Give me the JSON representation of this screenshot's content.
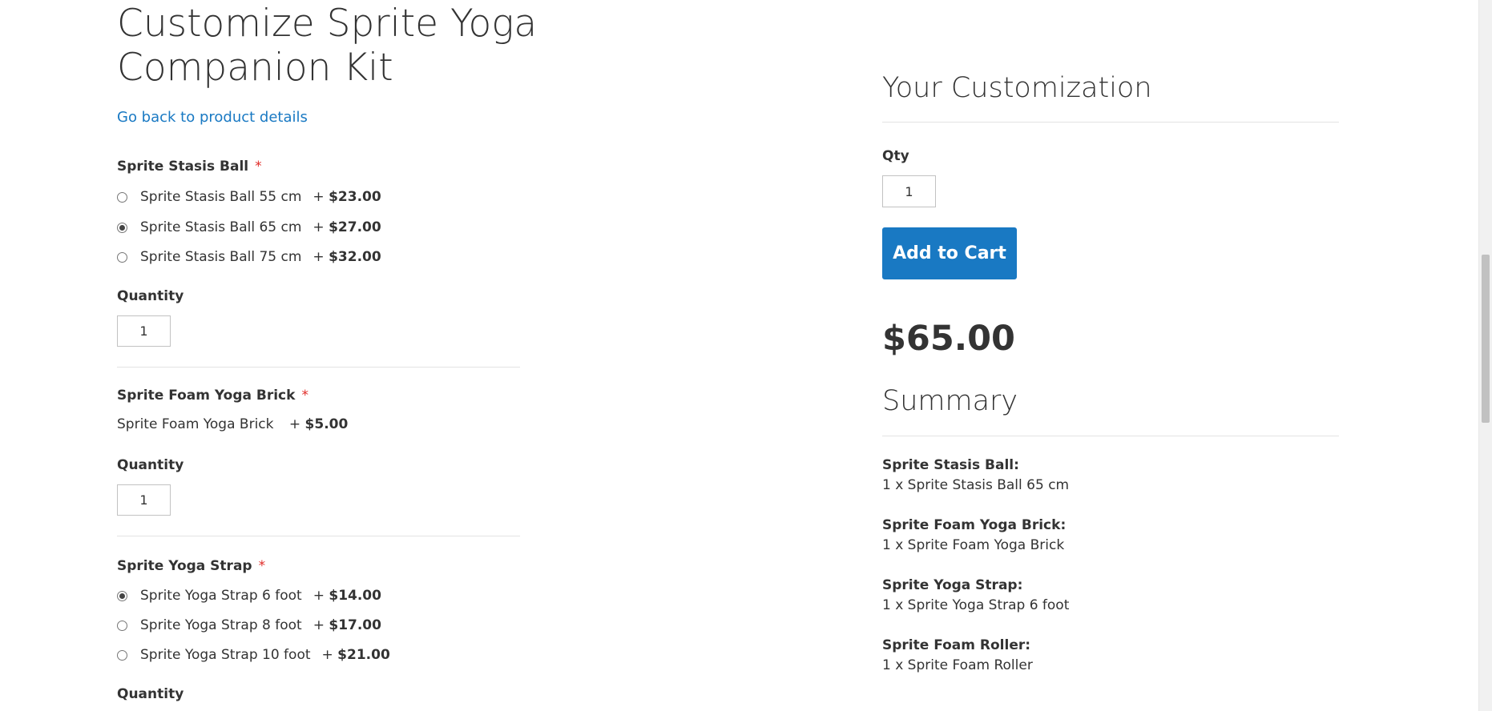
{
  "page": {
    "title_line1": "Customize Sprite Yoga",
    "title_line2": "Companion Kit",
    "back_link": "Go back to product details"
  },
  "options": {
    "ball": {
      "label": "Sprite Stasis Ball",
      "required_mark": "*",
      "choices": [
        {
          "name": "Sprite Stasis Ball 55 cm",
          "price_prefix": "+ ",
          "price": "$23.00",
          "selected": false
        },
        {
          "name": "Sprite Stasis Ball 65 cm",
          "price_prefix": "+ ",
          "price": "$27.00",
          "selected": true
        },
        {
          "name": "Sprite Stasis Ball 75 cm",
          "price_prefix": "+ ",
          "price": "$32.00",
          "selected": false
        }
      ],
      "qty_label": "Quantity",
      "qty_value": "1"
    },
    "brick": {
      "label": "Sprite Foam Yoga Brick",
      "required_mark": "*",
      "single_name": "Sprite Foam Yoga Brick",
      "price_prefix": "+ ",
      "price": "$5.00",
      "qty_label": "Quantity",
      "qty_value": "1"
    },
    "strap": {
      "label": "Sprite Yoga Strap",
      "required_mark": "*",
      "choices": [
        {
          "name": "Sprite Yoga Strap 6 foot",
          "price_prefix": "+ ",
          "price": "$14.00",
          "selected": true
        },
        {
          "name": "Sprite Yoga Strap 8 foot",
          "price_prefix": "+ ",
          "price": "$17.00",
          "selected": false
        },
        {
          "name": "Sprite Yoga Strap 10 foot",
          "price_prefix": "+ ",
          "price": "$21.00",
          "selected": false
        }
      ],
      "qty_label": "Quantity"
    }
  },
  "customization": {
    "title": "Your Customization",
    "qty_label": "Qty",
    "qty_value": "1",
    "add_to_cart": "Add to Cart",
    "total": "$65.00"
  },
  "summary": {
    "title": "Summary",
    "items": [
      {
        "label": "Sprite Stasis Ball:",
        "value": "1 x Sprite Stasis Ball 65 cm"
      },
      {
        "label": "Sprite Foam Yoga Brick:",
        "value": "1 x Sprite Foam Yoga Brick"
      },
      {
        "label": "Sprite Yoga Strap:",
        "value": "1 x Sprite Yoga Strap 6 foot"
      },
      {
        "label": "Sprite Foam Roller:",
        "value": "1 x Sprite Foam Roller"
      }
    ]
  },
  "colors": {
    "link": "#1979c3",
    "button": "#1979c3",
    "required": "#e02b27",
    "text": "#333333"
  }
}
